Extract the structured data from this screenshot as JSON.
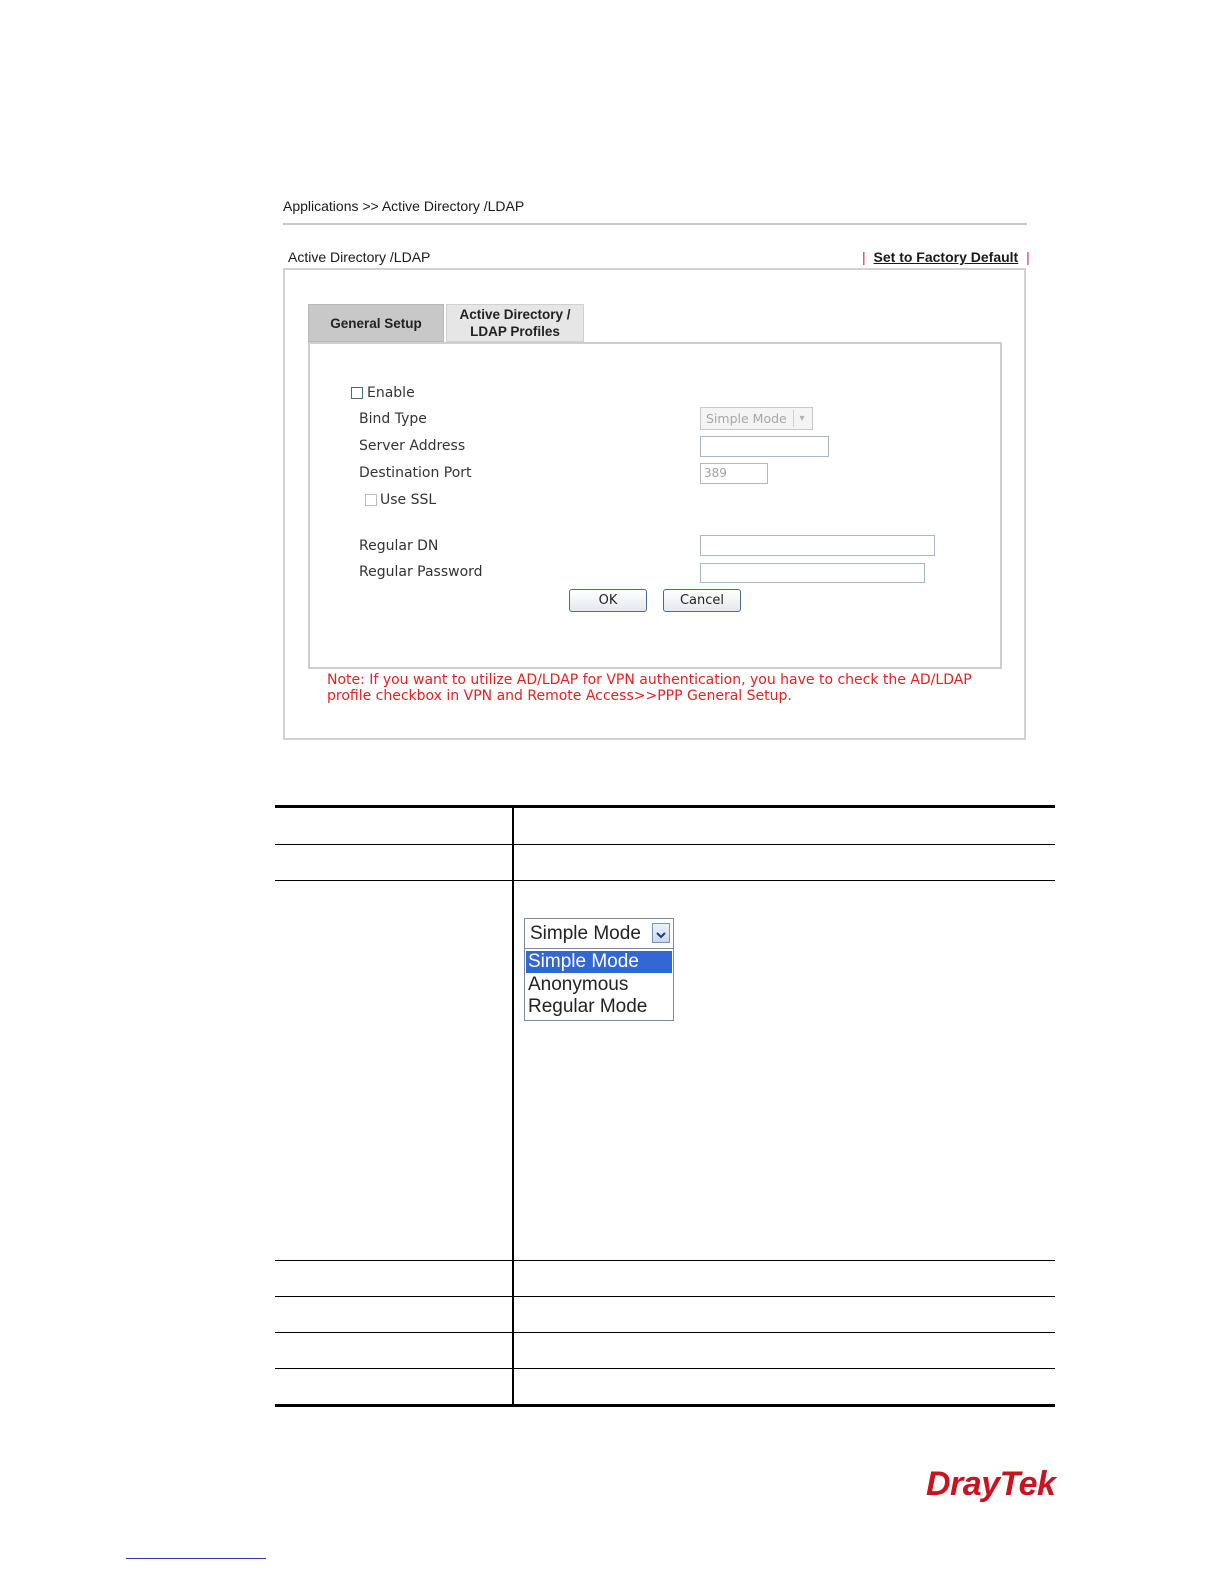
{
  "breadcrumb": "Applications >> Active Directory /LDAP",
  "panel": {
    "title": "Active Directory /LDAP",
    "factory_sep": "|",
    "factory_link": "Set to Factory Default"
  },
  "tabs": [
    {
      "label": "General Setup",
      "active": true
    },
    {
      "label_line1": "Active Directory /",
      "label_line2": "LDAP Profiles",
      "active": false
    }
  ],
  "form": {
    "enable_label": "Enable",
    "enable_checked": false,
    "bind_type_label": "Bind Type",
    "bind_type_value": "Simple Mode",
    "server_address_label": "Server Address",
    "server_address_value": "",
    "destination_port_label": "Destination Port",
    "destination_port_value": "389",
    "use_ssl_label": "Use SSL",
    "use_ssl_checked": false,
    "regular_dn_label": "Regular DN",
    "regular_dn_value": "",
    "regular_password_label": "Regular Password",
    "regular_password_value": "",
    "ok_label": "OK",
    "cancel_label": "Cancel"
  },
  "note": {
    "line1": "Note: If you want to utilize AD/LDAP for VPN authentication, you have to check the AD/LDAP",
    "line2": "profile checkbox in VPN and Remote Access>>PPP General Setup."
  },
  "bind_dropdown": {
    "current": "Simple Mode",
    "options": [
      "Simple Mode",
      "Anonymous",
      "Regular Mode"
    ],
    "highlighted_index": 0
  },
  "logo": "DrayTek",
  "colors": {
    "note_red": "#e82020",
    "link_sep_pink": "#e0205a",
    "highlight_blue": "#3367d6",
    "logo_red": "#c8141e"
  }
}
